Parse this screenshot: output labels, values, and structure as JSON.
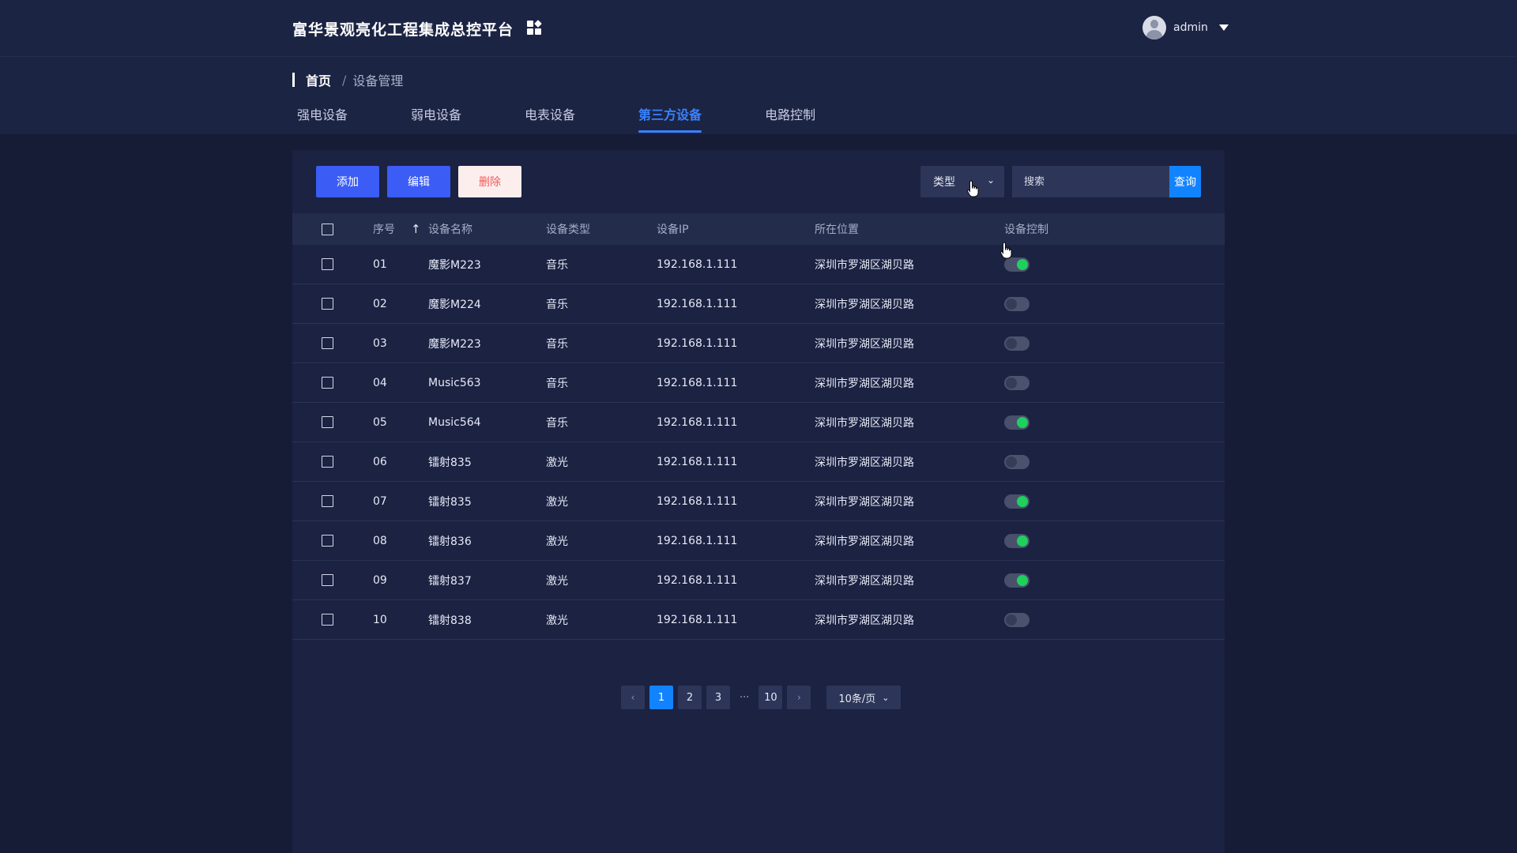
{
  "header": {
    "title": "富华景观亮化工程集成总控平台",
    "user": "admin"
  },
  "breadcrumb": {
    "home": "首页",
    "separator": "/",
    "current": "设备管理"
  },
  "tabs": [
    {
      "label": "强电设备",
      "active": false
    },
    {
      "label": "弱电设备",
      "active": false
    },
    {
      "label": "电表设备",
      "active": false
    },
    {
      "label": "第三方设备",
      "active": true
    },
    {
      "label": "电路控制",
      "active": false
    }
  ],
  "toolbar": {
    "add": "添加",
    "edit": "编辑",
    "delete": "删除",
    "type_select": "类型",
    "search_placeholder": "搜索",
    "search_button": "查询"
  },
  "table": {
    "headers": {
      "index": "序号",
      "name": "设备名称",
      "type": "设备类型",
      "ip": "设备IP",
      "location": "所在位置",
      "control": "设备控制"
    },
    "rows": [
      {
        "index": "01",
        "name": "魔影M223",
        "type": "音乐",
        "ip": "192.168.1.111",
        "location": "深圳市罗湖区湖贝路",
        "on": true
      },
      {
        "index": "02",
        "name": "魔影M224",
        "type": "音乐",
        "ip": "192.168.1.111",
        "location": "深圳市罗湖区湖贝路",
        "on": false
      },
      {
        "index": "03",
        "name": "魔影M223",
        "type": "音乐",
        "ip": "192.168.1.111",
        "location": "深圳市罗湖区湖贝路",
        "on": false
      },
      {
        "index": "04",
        "name": "Music563",
        "type": "音乐",
        "ip": "192.168.1.111",
        "location": "深圳市罗湖区湖贝路",
        "on": false
      },
      {
        "index": "05",
        "name": "Music564",
        "type": "音乐",
        "ip": "192.168.1.111",
        "location": "深圳市罗湖区湖贝路",
        "on": true
      },
      {
        "index": "06",
        "name": "镭射835",
        "type": "激光",
        "ip": "192.168.1.111",
        "location": "深圳市罗湖区湖贝路",
        "on": false
      },
      {
        "index": "07",
        "name": "镭射835",
        "type": "激光",
        "ip": "192.168.1.111",
        "location": "深圳市罗湖区湖贝路",
        "on": true
      },
      {
        "index": "08",
        "name": "镭射836",
        "type": "激光",
        "ip": "192.168.1.111",
        "location": "深圳市罗湖区湖贝路",
        "on": true
      },
      {
        "index": "09",
        "name": "镭射837",
        "type": "激光",
        "ip": "192.168.1.111",
        "location": "深圳市罗湖区湖贝路",
        "on": true
      },
      {
        "index": "10",
        "name": "镭射838",
        "type": "激光",
        "ip": "192.168.1.111",
        "location": "深圳市罗湖区湖贝路",
        "on": false
      }
    ]
  },
  "pagination": {
    "pages": [
      "1",
      "2",
      "3"
    ],
    "ellipsis": "···",
    "last": "10",
    "current": "1",
    "page_size": "10条/页"
  },
  "icons": {
    "prev": "chevron-left-icon",
    "next": "chevron-right-icon",
    "sort": "arrow-up-icon",
    "apps": "grid-icon",
    "caret": "caret-down-icon"
  },
  "colors": {
    "accent": "#3b5cf5",
    "primary_blue": "#1283ff",
    "toggle_on": "#1fd05c",
    "delete_text": "#f15a5a",
    "active_tab": "#3a82ff"
  }
}
